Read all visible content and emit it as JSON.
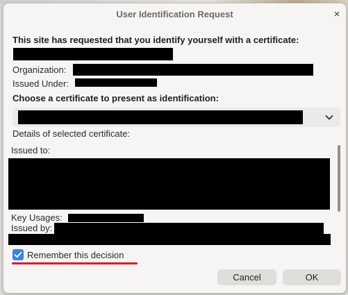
{
  "dialog": {
    "title": "User Identification Request",
    "close_glyph": "×",
    "intro_heading": "This site has requested that you identify yourself with a certificate:",
    "organization_label": "Organization:",
    "issued_under_label": "Issued Under:",
    "choose_heading": "Choose a certificate to present as identification:",
    "details_label": "Details of selected certificate:",
    "issued_to_label": "Issued to:",
    "key_usages_label": "Key Usages:",
    "issued_by_label": "Issued by:",
    "remember_label": "Remember this decision",
    "remember_checked": true,
    "cancel_label": "Cancel",
    "ok_label": "OK"
  },
  "icons": {
    "close": "close-icon",
    "dropdown": "chevron-down-icon",
    "check": "checkmark-icon"
  },
  "colors": {
    "accent": "#3584e4",
    "highlight_underline": "#e01b24",
    "redaction": "#000000"
  }
}
